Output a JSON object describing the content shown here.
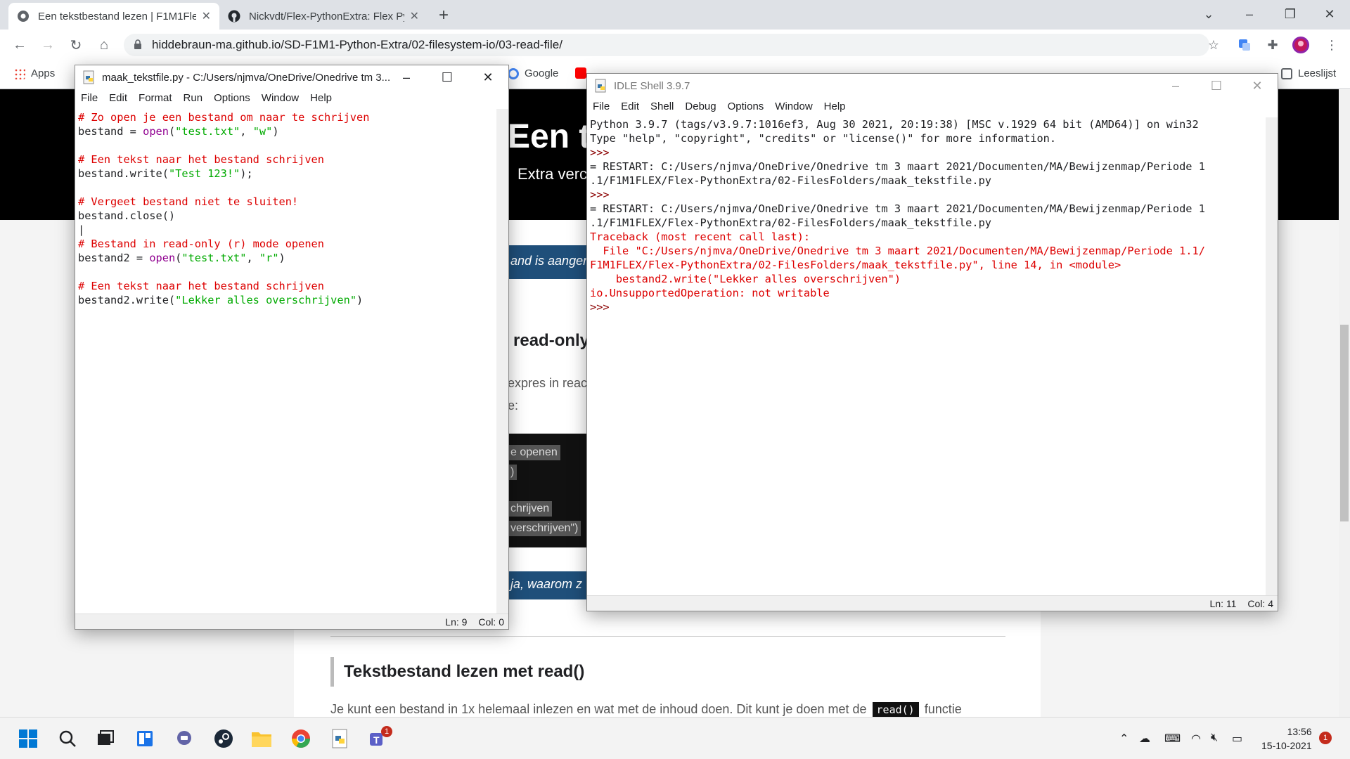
{
  "browser": {
    "tabs": [
      {
        "title": "Een tekstbestand lezen | F1M1Fle",
        "close": "✕"
      },
      {
        "title": "Nickvdt/Flex-PythonExtra: Flex Py",
        "close": "✕"
      }
    ],
    "new_tab": "+",
    "url": "hiddebraun-ma.github.io/SD-F1M1-Python-Extra/02-filesystem-io/03-read-file/",
    "bookmarks": {
      "apps": "Apps",
      "google": "Google",
      "reading_list": "Leeslijst"
    }
  },
  "page": {
    "hero_title": "Een t",
    "hero_subtitle": "Extra verc",
    "banner1": "and is aangen",
    "heading_readonly": "read-only",
    "para_expres": "expres in reac",
    "para_colon": "e:",
    "code_lines": [
      "e openen",
      ")",
      "chrijven",
      "verschrijven\")"
    ],
    "banner2": "ja, waarom z",
    "heading_read": "Tekstbestand lezen met read()",
    "para_read_before": "Je kunt een bestand in 1x helemaal inlezen en wat met de inhoud doen. Dit kunt je doen met de",
    "para_read_code": "read()",
    "para_read_after": "functie"
  },
  "editor": {
    "title": "maak_tekstfile.py - C:/Users/njmva/OneDrive/Onedrive tm 3...",
    "menu": [
      "File",
      "Edit",
      "Format",
      "Run",
      "Options",
      "Window",
      "Help"
    ],
    "code": [
      {
        "parts": [
          {
            "t": "# Zo open je een bestand om naar te schrijven",
            "c": "cmt"
          }
        ]
      },
      {
        "parts": [
          {
            "t": "bestand = ",
            "c": ""
          },
          {
            "t": "open",
            "c": "bi"
          },
          {
            "t": "(",
            "c": ""
          },
          {
            "t": "\"test.txt\"",
            "c": "str"
          },
          {
            "t": ", ",
            "c": ""
          },
          {
            "t": "\"w\"",
            "c": "str"
          },
          {
            "t": ")",
            "c": ""
          }
        ]
      },
      {
        "parts": [
          {
            "t": "",
            "c": ""
          }
        ]
      },
      {
        "parts": [
          {
            "t": "# Een tekst naar het bestand schrijven",
            "c": "cmt"
          }
        ]
      },
      {
        "parts": [
          {
            "t": "bestand.write(",
            "c": ""
          },
          {
            "t": "\"Test 123!\"",
            "c": "str"
          },
          {
            "t": ");",
            "c": ""
          }
        ]
      },
      {
        "parts": [
          {
            "t": "",
            "c": ""
          }
        ]
      },
      {
        "parts": [
          {
            "t": "# Vergeet bestand niet te sluiten!",
            "c": "cmt"
          }
        ]
      },
      {
        "parts": [
          {
            "t": "bestand.close()",
            "c": ""
          }
        ]
      },
      {
        "parts": [
          {
            "t": "|",
            "c": ""
          }
        ]
      },
      {
        "parts": [
          {
            "t": "# Bestand in read-only (r) mode openen",
            "c": "cmt"
          }
        ]
      },
      {
        "parts": [
          {
            "t": "bestand2 = ",
            "c": ""
          },
          {
            "t": "open",
            "c": "bi"
          },
          {
            "t": "(",
            "c": ""
          },
          {
            "t": "\"test.txt\"",
            "c": "str"
          },
          {
            "t": ", ",
            "c": ""
          },
          {
            "t": "\"r\"",
            "c": "str"
          },
          {
            "t": ")",
            "c": ""
          }
        ]
      },
      {
        "parts": [
          {
            "t": "",
            "c": ""
          }
        ]
      },
      {
        "parts": [
          {
            "t": "# Een tekst naar het bestand schrijven",
            "c": "cmt"
          }
        ]
      },
      {
        "parts": [
          {
            "t": "bestand2.write(",
            "c": ""
          },
          {
            "t": "\"Lekker alles overschrijven\"",
            "c": "str"
          },
          {
            "t": ")",
            "c": ""
          }
        ]
      }
    ],
    "status_ln": "Ln: 9",
    "status_col": "Col: 0"
  },
  "shell": {
    "title": "IDLE Shell 3.9.7",
    "menu": [
      "File",
      "Edit",
      "Shell",
      "Debug",
      "Options",
      "Window",
      "Help"
    ],
    "lines": [
      {
        "t": "Python 3.9.7 (tags/v3.9.7:1016ef3, Aug 30 2021, 20:19:38) [MSC v.1929 64 bit (AMD64)] on win32",
        "c": ""
      },
      {
        "t": "Type \"help\", \"copyright\", \"credits\" or \"license()\" for more information.",
        "c": ""
      },
      {
        "t": ">>>",
        "c": "prm"
      },
      {
        "t": "= RESTART: C:/Users/njmva/OneDrive/Onedrive tm 3 maart 2021/Documenten/MA/Bewijzenmap/Periode 1",
        "c": ""
      },
      {
        "t": ".1/F1M1FLEX/Flex-PythonExtra/02-FilesFolders/maak_tekstfile.py",
        "c": ""
      },
      {
        "t": ">>>",
        "c": "prm"
      },
      {
        "t": "= RESTART: C:/Users/njmva/OneDrive/Onedrive tm 3 maart 2021/Documenten/MA/Bewijzenmap/Periode 1",
        "c": ""
      },
      {
        "t": ".1/F1M1FLEX/Flex-PythonExtra/02-FilesFolders/maak_tekstfile.py",
        "c": ""
      },
      {
        "t": "Traceback (most recent call last):",
        "c": "err"
      },
      {
        "t": "  File \"C:/Users/njmva/OneDrive/Onedrive tm 3 maart 2021/Documenten/MA/Bewijzenmap/Periode 1.1/",
        "c": "err"
      },
      {
        "t": "F1M1FLEX/Flex-PythonExtra/02-FilesFolders/maak_tekstfile.py\", line 14, in <module>",
        "c": "err"
      },
      {
        "t": "    bestand2.write(\"Lekker alles overschrijven\")",
        "c": "err"
      },
      {
        "t": "io.UnsupportedOperation: not writable",
        "c": "err"
      },
      {
        "t": ">>>",
        "c": "prm"
      }
    ],
    "status_ln": "Ln: 11",
    "status_col": "Col: 4"
  },
  "taskbar": {
    "time": "13:56",
    "date": "15-10-2021",
    "teams_badge": "1",
    "notif_badge": "1"
  }
}
